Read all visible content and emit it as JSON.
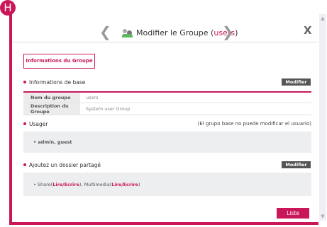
{
  "badge": "H",
  "header": {
    "title_prefix": "Modifier le Groupe (",
    "group_name": "users",
    "title_suffix": ")",
    "prev_glyph": "❮",
    "next_glyph": "❯",
    "close_glyph": "X"
  },
  "tab_label": "Informations du Groupe",
  "basic_info": {
    "heading": "Informations de base",
    "modify_label": "Modifier",
    "rows": [
      {
        "label": "Nom du groupe",
        "value": "users"
      },
      {
        "label": "Description du Groupe",
        "value": "System user Group"
      }
    ]
  },
  "users": {
    "heading": "Usager",
    "note": "(El grupo base no puede modificar el usuario)",
    "list": "• admin, guest"
  },
  "shared": {
    "heading": "Ajoutez un dossier partagé",
    "modify_label": "Modifier",
    "item1_name": "Share(",
    "item1_perm": "Lire/Ecrire",
    "item1_sep": "), Multimedia(",
    "item2_perm": "Lire/Ecrire",
    "item2_end": ")"
  },
  "footer": {
    "list_button": "Liste"
  },
  "colors": {
    "accent": "#c9175a",
    "button_dark": "#555555",
    "panel_gray": "#eceef0"
  }
}
